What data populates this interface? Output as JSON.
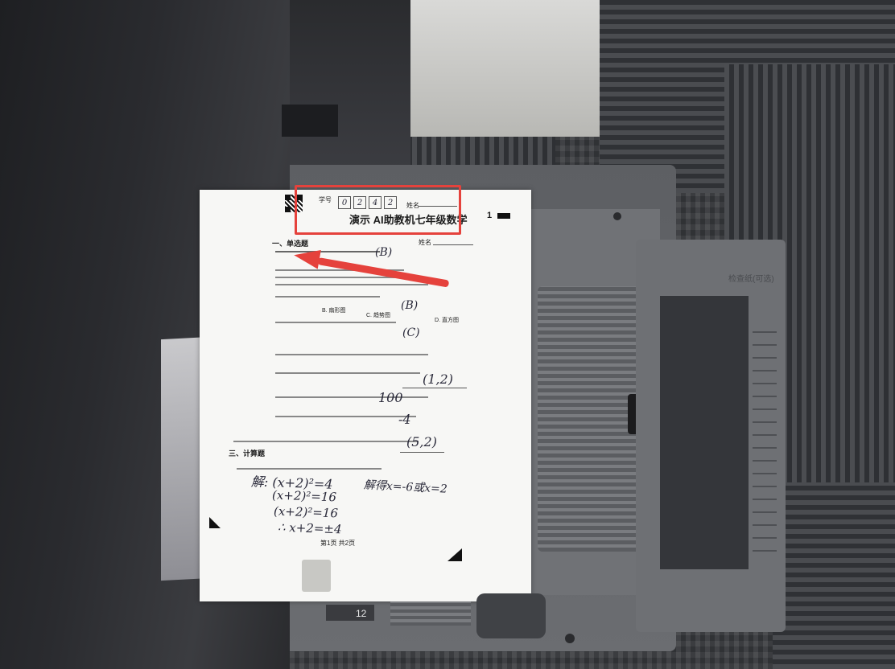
{
  "sheet": {
    "header_label_id": "学号",
    "header_label_name": "姓名",
    "student_id_digits": [
      "0",
      "2",
      "4",
      "2"
    ],
    "title": "演示 AI助教机七年级数学",
    "page_marker": "1",
    "name_line_label": "姓名",
    "section_1": "一、单选题",
    "section_3": "三、计算题",
    "footer": "第1页  共2页",
    "answers": {
      "q1": "(B)",
      "q2": "(B)",
      "q3": "(C)",
      "blank_a": "(1,2)",
      "blank_b": "100",
      "blank_c": "-4",
      "blank_d": "(5,2)"
    },
    "options_q2": [
      "B. 扇形图",
      "C. 趋势图",
      "D. 直方图"
    ],
    "handwriting": {
      "line1": "解: (x+2)²=4",
      "line1_right": "解得x=-6或x=2",
      "line2": "(x+2)²=16",
      "line3": "(x+2)²=16",
      "line4": "∴ x+2=±4"
    }
  },
  "tray_label": "12",
  "extension_label": "检查纸(可选)",
  "annotation_color": "#e5423c"
}
